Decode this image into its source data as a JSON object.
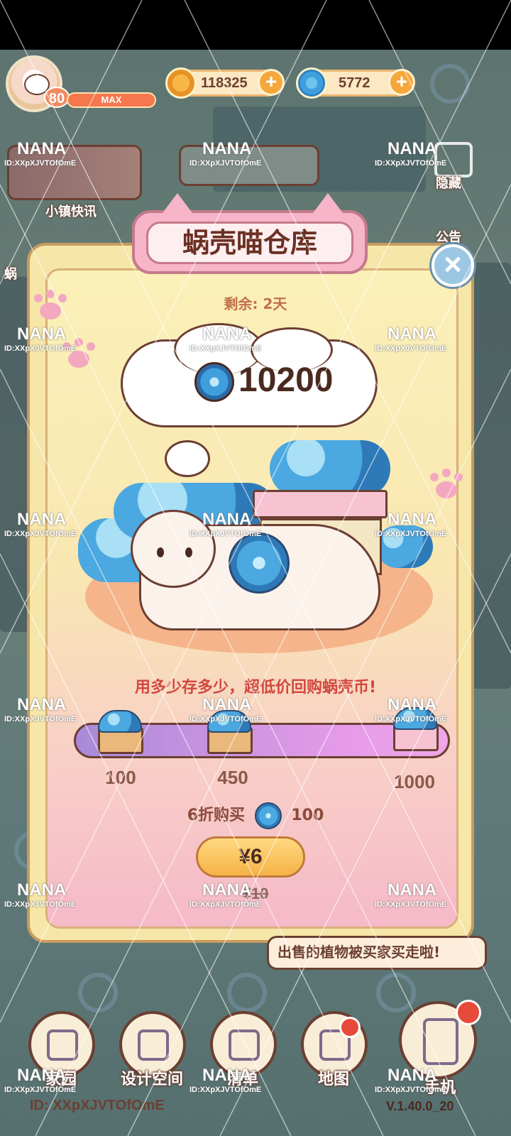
{
  "hud": {
    "level": "80",
    "level_status": "MAX",
    "gold_amount": "118325",
    "shell_amount": "5772",
    "plus_label": "+"
  },
  "side": {
    "news_label": "小镇快讯",
    "hide_label": "隐藏",
    "notice_label": "公告",
    "left_label": "蜗"
  },
  "popup": {
    "title": "蜗壳喵仓库",
    "close_label": "×",
    "remaining": "剩余: 2天",
    "stored_amount": "10200",
    "slogan": "用多少存多少，超低价回购蜗壳币!",
    "tiers": [
      "100",
      "450",
      "1000"
    ],
    "buy_prefix": "6折购买",
    "buy_amount": "100",
    "price": "¥6",
    "original_price": "¥10"
  },
  "toast": "出售的植物被买家买走啦!",
  "nav": [
    {
      "label": "家园"
    },
    {
      "label": "设计空间"
    },
    {
      "label": "清单"
    },
    {
      "label": "地图"
    },
    {
      "label": "手机"
    }
  ],
  "footer": {
    "id": "ID: XXpXJVTOfOmE",
    "version": "V.1.40.0_20"
  },
  "watermark": {
    "name": "NANA",
    "id": "ID:XXpXJVTOfOmE"
  },
  "colors": {
    "title_text": "#6b3023",
    "slogan": "#d1473f",
    "remaining": "#c1704b",
    "price_button": "#f4b246",
    "panel_bg": "#fbf0b8"
  }
}
